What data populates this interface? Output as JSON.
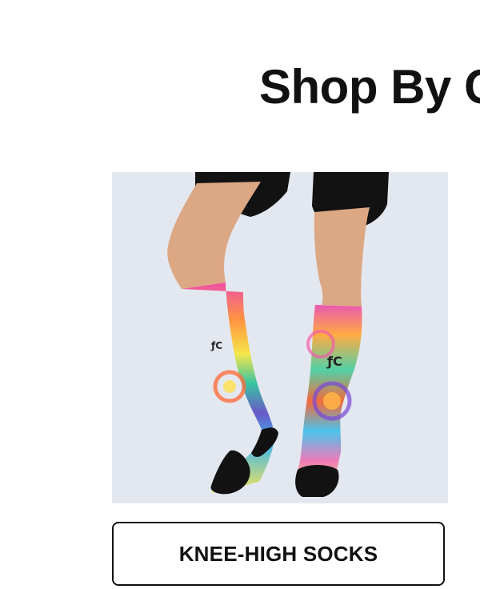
{
  "section": {
    "title": "Shop By C"
  },
  "category": {
    "image_alt": "Knee-high tie-dye compression socks",
    "image_logo_icon": "brand-logo-icon",
    "button_label": "KNEE-HIGH SOCKS"
  },
  "colors": {
    "image_background": "#e3e8f0",
    "button_border": "#111111",
    "text": "#111111"
  }
}
